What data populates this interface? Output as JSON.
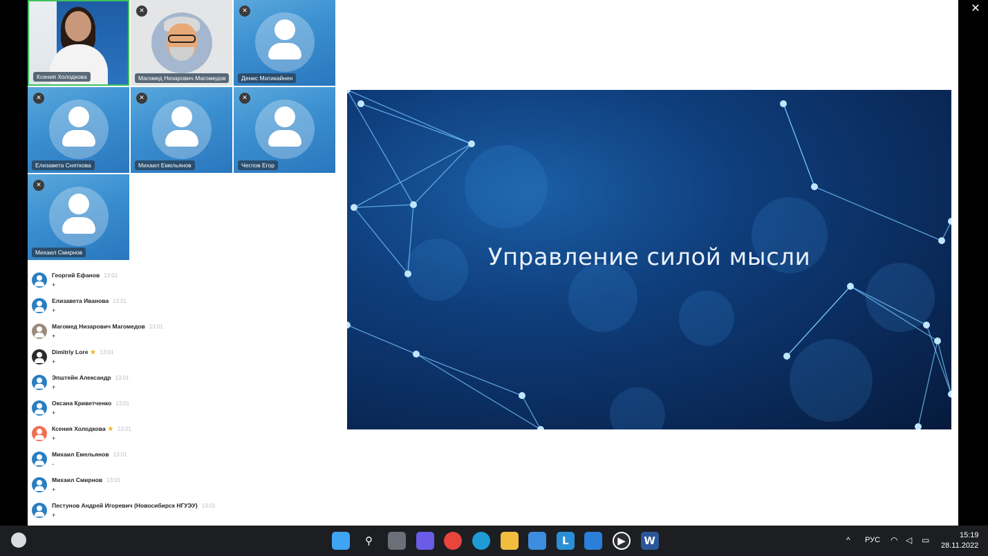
{
  "window": {
    "close_glyph": "✕"
  },
  "participants": [
    {
      "name": "Ксения Холодкова",
      "kind": "photo",
      "active": true,
      "muted": false
    },
    {
      "name": "Магомед Низарович Магомедов",
      "kind": "memoji",
      "active": false,
      "muted": true
    },
    {
      "name": "Денис Матикайнен",
      "kind": "placeholder",
      "active": false,
      "muted": true
    },
    {
      "name": "Елизавета Сняткова",
      "kind": "placeholder",
      "active": false,
      "muted": true
    },
    {
      "name": "Михаил Емельянов",
      "kind": "placeholder",
      "active": false,
      "muted": true
    },
    {
      "name": "Чеглов Егор",
      "kind": "placeholder",
      "active": false,
      "muted": true
    },
    {
      "name": "Михаил Смирнов",
      "kind": "placeholder",
      "active": false,
      "muted": true
    }
  ],
  "chat": [
    {
      "author": "Георгий Ефанов",
      "time": "13:01",
      "text": "+",
      "avatar": "default",
      "star": false
    },
    {
      "author": "Елизавета Иванова",
      "time": "13:01",
      "text": "+",
      "avatar": "default",
      "star": false
    },
    {
      "author": "Магомед Низарович Магомедов",
      "time": "13:01",
      "text": "+",
      "avatar": "photo",
      "star": false
    },
    {
      "author": "Dimitriy Lore",
      "time": "13:01",
      "text": "+",
      "avatar": "dark",
      "star": true
    },
    {
      "author": "Эпштейн Александр",
      "time": "13:01",
      "text": "+",
      "avatar": "default",
      "star": false
    },
    {
      "author": "Оксана Криветченко",
      "time": "13:01",
      "text": "+",
      "avatar": "default",
      "star": false
    },
    {
      "author": "Ксения Холодкова",
      "time": "13:01",
      "text": "+",
      "avatar": "orange",
      "star": true
    },
    {
      "author": "Михаил Емельянов",
      "time": "13:01",
      "text": "-",
      "avatar": "default",
      "star": false
    },
    {
      "author": "Михаил Смирнов",
      "time": "13:01",
      "text": "+",
      "avatar": "default",
      "star": false
    },
    {
      "author": "Пестунов Андрей Игоревич (Новосибирск НГУЭУ)",
      "time": "13:01",
      "text": "+",
      "avatar": "default",
      "star": false
    }
  ],
  "slide": {
    "title": "Управление силой мысли"
  },
  "taskbar": {
    "apps": [
      "windows-start-icon",
      "search-icon",
      "task-view-icon",
      "teams-chat-icon",
      "chrome-icon",
      "edge-icon",
      "file-explorer-icon",
      "store-icon",
      "l-app-icon",
      "mail-icon",
      "media-player-icon",
      "word-icon"
    ],
    "language": "РУС",
    "time": "15:19",
    "date": "28.11.2022"
  }
}
